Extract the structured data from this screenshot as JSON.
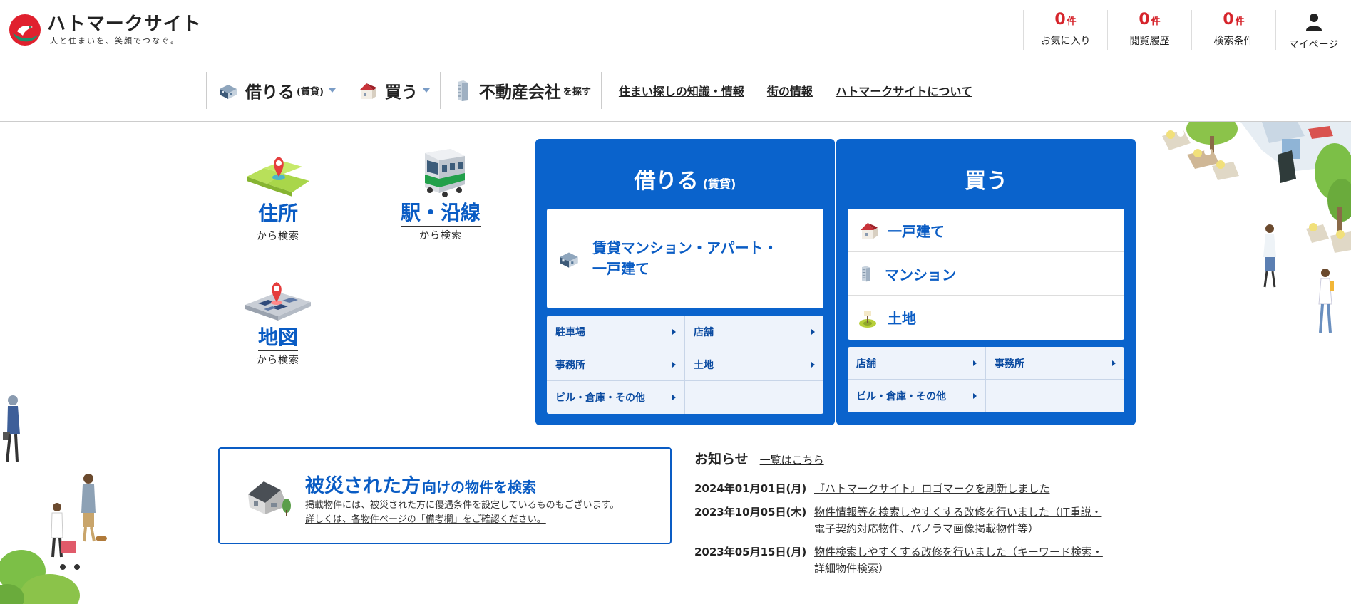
{
  "header": {
    "logo_name": "ハトマークサイト",
    "logo_tagline": "人と住まいを、笑顔でつなぐ。",
    "counters": [
      {
        "num": "0",
        "unit": "件",
        "label": "お気に入り"
      },
      {
        "num": "0",
        "unit": "件",
        "label": "閲覧履歴"
      },
      {
        "num": "0",
        "unit": "件",
        "label": "検索条件"
      }
    ],
    "mypage_label": "マイページ"
  },
  "gnav": {
    "rent": {
      "label": "借りる",
      "sub": "(賃貸)"
    },
    "buy": {
      "label": "買う"
    },
    "company": {
      "label": "不動産会社",
      "sub": "を探す"
    },
    "links": [
      "住まい探しの知識・情報",
      "街の情報",
      "ハトマークサイトについて"
    ]
  },
  "search_methods": {
    "address": {
      "big": "住所",
      "small": "から検索"
    },
    "station": {
      "big": "駅・沿線",
      "small": "から検索"
    },
    "map": {
      "big": "地図",
      "small": "から検索"
    }
  },
  "rent_panel": {
    "title": "借りる",
    "title_sub": "(賃貸)",
    "main_line1": "賃貸マンション・アパート・",
    "main_line2": "一戸建て",
    "sub_items": [
      "駐車場",
      "店舗",
      "事務所",
      "土地",
      "ビル・倉庫・その他",
      ""
    ]
  },
  "buy_panel": {
    "title": "買う",
    "items": [
      "一戸建て",
      "マンション",
      "土地"
    ],
    "sub_items": [
      "店舗",
      "事務所",
      "ビル・倉庫・その他",
      ""
    ]
  },
  "disaster": {
    "title": "被災された方",
    "title_sub": "向けの物件を検索",
    "desc_line1": "掲載物件には、被災された方に優遇条件を設定しているものもございます。",
    "desc_line2": "詳しくは、各物件ページの「備考欄」をご確認ください。"
  },
  "news": {
    "title": "お知らせ",
    "all_link": "一覧はこちら",
    "items": [
      {
        "date": "2024年01月01日(月)",
        "line1": "『ハトマークサイト』ロゴマークを刷新しました",
        "line2": ""
      },
      {
        "date": "2023年10月05日(木)",
        "line1": "物件情報等を検索しやすくする改修を行いました（IT重説・",
        "line2": "電子契約対応物件、パノラマ画像掲載物件等）"
      },
      {
        "date": "2023年05月15日(月)",
        "line1": "物件検索しやすくする改修を行いました（キーワード検索・",
        "line2": "詳細物件検索）"
      }
    ]
  },
  "colors": {
    "brand_blue": "#0a63cc",
    "accent_red": "#d6242b",
    "logo_green": "#1e8f6c"
  }
}
